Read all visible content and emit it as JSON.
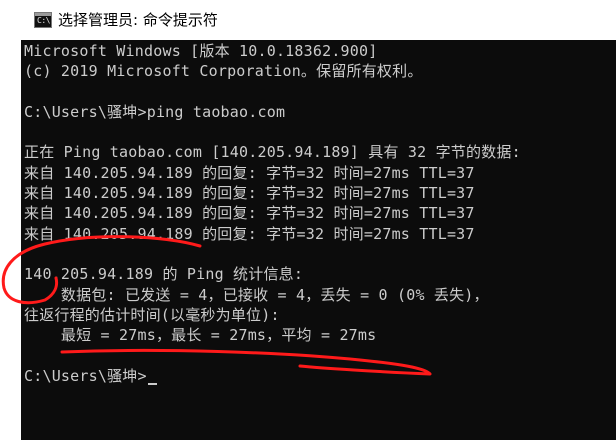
{
  "window": {
    "title": "选择管理员: 命令提示符",
    "icon": "cmd-icon",
    "icon_glyph": "C:\\"
  },
  "console": {
    "background": "#0c0c0c",
    "foreground": "#cccccc",
    "lines": [
      "Microsoft Windows [版本 10.0.18362.900]",
      "(c) 2019 Microsoft Corporation。保留所有权利。",
      "",
      "C:\\Users\\骚坤>ping taobao.com",
      "",
      "正在 Ping taobao.com [140.205.94.189] 具有 32 字节的数据:",
      "来自 140.205.94.189 的回复: 字节=32 时间=27ms TTL=37",
      "来自 140.205.94.189 的回复: 字节=32 时间=27ms TTL=37",
      "来自 140.205.94.189 的回复: 字节=32 时间=27ms TTL=37",
      "来自 140.205.94.189 的回复: 字节=32 时间=27ms TTL=37",
      "",
      "140.205.94.189 的 Ping 统计信息:",
      "    数据包: 已发送 = 4，已接收 = 4，丢失 = 0 (0% 丢失)，",
      "往返行程的估计时间(以毫秒为单位):",
      "    最短 = 27ms，最长 = 27ms，平均 = 27ms",
      "",
      "C:\\Users\\骚坤>"
    ]
  },
  "annotations": {
    "color": "#ff1a1a"
  }
}
